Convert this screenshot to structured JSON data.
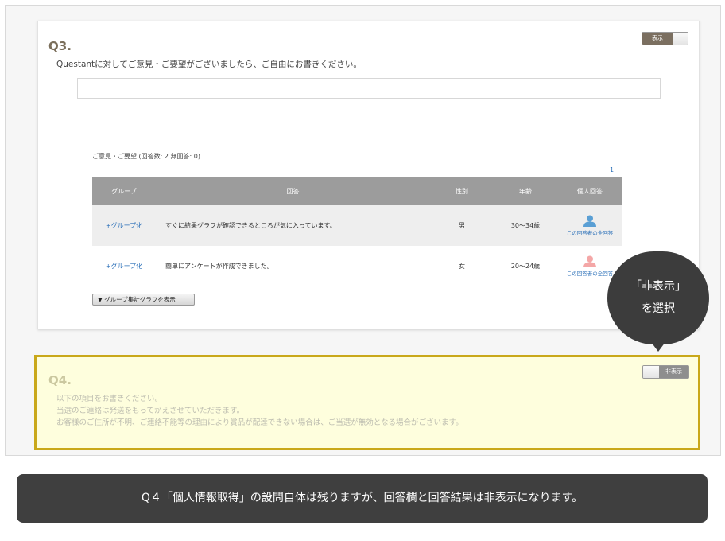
{
  "q3": {
    "title": "Q3.",
    "description": "Questantに対してご意見・ご要望がございましたら、ご自由にお書きください。",
    "toggle_label": "表示",
    "summary": "ご意見・ご要望 (回答数: 2 無回答: 0)",
    "page_number": "1",
    "table": {
      "headers": [
        "グループ",
        "回答",
        "性別",
        "年齢",
        "個人回答"
      ],
      "rows": [
        {
          "group_link": "+グループ化",
          "answer": "すぐに結果グラフが確認できるところが気に入っています。",
          "gender": "男",
          "age": "30〜34歳",
          "person_link": "この回答者の全回答",
          "person_color": "#5a9fd4"
        },
        {
          "group_link": "+グループ化",
          "answer": "簡単にアンケートが作成できました。",
          "gender": "女",
          "age": "20〜24歳",
          "person_link": "この回答者の全回答",
          "person_color": "#f4a7a7"
        }
      ]
    },
    "group_graph_button": "▼ グループ集計グラフを表示"
  },
  "tooltip": {
    "line1": "「非表示」",
    "line2": "を選択"
  },
  "q4": {
    "title": "Q4.",
    "toggle_label": "非表示",
    "lines": [
      "以下の項目をお書きください。",
      "当選のご連絡は発送をもってかえさせていただきます。",
      "お客様のご住所が不明、ご連絡不能等の理由により賞品が配達できない場合は、ご当選が無効となる場合がございます。"
    ]
  },
  "caption": "Q４「個人情報取得」の設問自体は残りますが、回答欄と回答結果は非表示になります。",
  "colors": {
    "q4_border": "#c9a81a",
    "q4_background": "#fefedd",
    "link": "#2a6fb8",
    "toggle_on": "#7b6f60"
  }
}
